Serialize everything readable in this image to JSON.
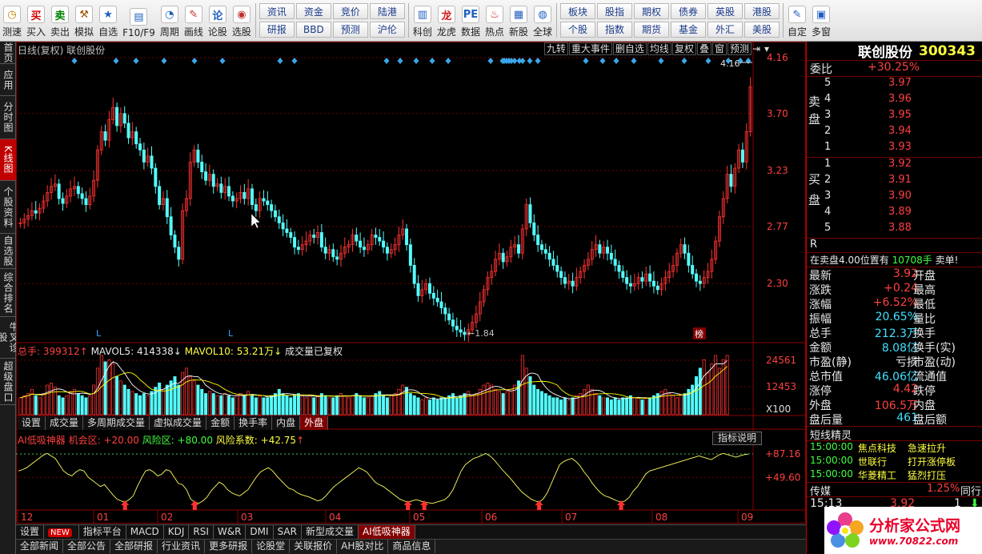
{
  "toolbar": {
    "buttons": [
      {
        "label": "测速",
        "icon": "clock-icon"
      },
      {
        "label": "买入",
        "icon": "buy-icon"
      },
      {
        "label": "卖出",
        "icon": "sell-icon"
      },
      {
        "label": "模拟",
        "icon": "hammer-icon"
      },
      {
        "label": "自选",
        "icon": "star-icon"
      },
      {
        "label": "F10/F9",
        "icon": "f10-icon"
      },
      {
        "label": "周期",
        "icon": "cycle-icon"
      },
      {
        "label": "画线",
        "icon": "pencil-icon"
      },
      {
        "label": "论股",
        "icon": "forum-icon"
      },
      {
        "label": "选股",
        "icon": "stock-pick-icon"
      }
    ],
    "grid1": [
      "资讯",
      "资金",
      "竞价",
      "陆港",
      "研报",
      "BBD",
      "预测",
      "沪伦"
    ],
    "buttons2": [
      {
        "label": "科创",
        "icon": "chart-icon"
      },
      {
        "label": "龙虎",
        "icon": "dragon-icon"
      },
      {
        "label": "数据",
        "icon": "pe-icon"
      },
      {
        "label": "热点",
        "icon": "hot-icon"
      },
      {
        "label": "新股",
        "icon": "new-stock-icon"
      },
      {
        "label": "全球",
        "icon": "globe-icon"
      }
    ],
    "grid2": [
      "板块",
      "股指",
      "期权",
      "债券",
      "英股",
      "港股",
      "个股",
      "指数",
      "期货",
      "基金",
      "外汇",
      "美股"
    ],
    "buttons3": [
      {
        "label": "自定",
        "icon": "custom-icon"
      },
      {
        "label": "多窗",
        "icon": "multi-window-icon"
      }
    ]
  },
  "lefttabs": [
    "首页",
    "应用",
    "分时图",
    "K线图",
    "个股资料",
    "自选股",
    "综合排名",
    "牛叉诊股",
    "超级盘口"
  ],
  "main": {
    "header": "日线(复权) 联创股份",
    "tools": [
      "九转",
      "重大事件",
      "删自选",
      "均线",
      "复权",
      "叠",
      "窗",
      "预测"
    ],
    "price_marker": "4.16",
    "low_marker": "1.84",
    "bang_label": "榜",
    "l_labels": [
      "L",
      "L"
    ],
    "yticks": [
      "4.16",
      "3.70",
      "3.23",
      "2.77",
      "2.30"
    ]
  },
  "volume": {
    "legend_total_label": "总手: 399312",
    "legend_mavol5": "MAVOL5: 414338",
    "legend_mavol10": "MAVOL10: 53.21万",
    "legend_note": "成交量已复权",
    "yticks": [
      "24561",
      "12453",
      "X100"
    ],
    "tabs": [
      "设置",
      "成交量",
      "多周期成交量",
      "虚拟成交量",
      "金额",
      "换手率",
      "内盘",
      "外盘"
    ]
  },
  "indicator": {
    "name": "AI低吸神器",
    "p1": "机会区: +20.00",
    "p2": "风险区: +80.00",
    "p3": "风险系数: +42.75",
    "button": "指标说明",
    "yticks": [
      "+87.16",
      "+49.60"
    ]
  },
  "xaxis": [
    "12",
    "01",
    "02",
    "03",
    "04",
    "05",
    "06",
    "07",
    "08",
    "09"
  ],
  "bottomtabs": [
    "设置",
    "NEW",
    "指标平台",
    "MACD",
    "KDJ",
    "RSI",
    "W&R",
    "DMI",
    "SAR",
    "新型成交量",
    "AI低吸神器"
  ],
  "bottomtabs2": [
    "全部新闻",
    "全部公告",
    "全部研报",
    "行业资讯",
    "更多研报",
    "论股堂",
    "关联报价",
    "AH股对比",
    "商品信息"
  ],
  "right": {
    "name": "联创股份",
    "code": "300343",
    "weibi_label": "委比",
    "weibi_value": "+30.25%",
    "sell_label": "卖盘",
    "buy_label": "买盘",
    "sells": [
      {
        "n": "5",
        "p": "3.97"
      },
      {
        "n": "4",
        "p": "3.96"
      },
      {
        "n": "3",
        "p": "3.95"
      },
      {
        "n": "2",
        "p": "3.94"
      },
      {
        "n": "1",
        "p": "3.93"
      }
    ],
    "buys": [
      {
        "n": "1",
        "p": "3.92"
      },
      {
        "n": "2",
        "p": "3.91"
      },
      {
        "n": "3",
        "p": "3.90"
      },
      {
        "n": "4",
        "p": "3.89"
      },
      {
        "n": "5",
        "p": "3.88"
      }
    ],
    "r_label": "R",
    "notice_prefix": "在卖盘4.00位置有",
    "notice_qty": "10708手",
    "notice_suffix": "卖单!",
    "stats": [
      {
        "l": "最新",
        "v": "3.92",
        "vc": "red",
        "l2": "开盘"
      },
      {
        "l": "涨跌",
        "v": "+0.24",
        "vc": "red",
        "l2": "最高"
      },
      {
        "l": "涨幅",
        "v": "+6.52%",
        "vc": "red",
        "l2": "最低"
      },
      {
        "l": "振幅",
        "v": "20.65%",
        "vc": "cyan",
        "l2": "量比"
      },
      {
        "l": "总手",
        "v": "212.3万",
        "vc": "cyan",
        "l2": "换手"
      },
      {
        "l": "金额",
        "v": "8.08亿",
        "vc": "cyan",
        "l2": "换手(实)"
      },
      {
        "l": "市盈(静)",
        "v": "亏损",
        "vc": "white",
        "l2": "市盈(动)"
      },
      {
        "l": "总市值",
        "v": "46.06亿",
        "vc": "cyan",
        "l2": "流通值"
      },
      {
        "l": "涨停",
        "v": "4.42",
        "vc": "red",
        "l2": "跌停"
      },
      {
        "l": "外盘",
        "v": "106.5万",
        "vc": "red",
        "l2": "内盘"
      },
      {
        "l": "盘后量",
        "v": "461",
        "vc": "cyan",
        "l2": "盘后额"
      }
    ],
    "elf_title": "短线精灵",
    "elf": [
      {
        "t": "15:00:00",
        "s": "焦点科技",
        "e": "急速拉升"
      },
      {
        "t": "15:00:00",
        "s": "世联行",
        "e": "打开涨停板"
      },
      {
        "t": "15:00:00",
        "s": "华菱精工",
        "e": "猛烈打压"
      }
    ],
    "sector_name": "传媒",
    "sector_pct": "1.25%",
    "sector_more": "同行",
    "tick_time": "15:13",
    "tick_price": "3.92",
    "tick_vol": "1",
    "logo_text": "分析家公式网",
    "logo_url": "www.70822.com"
  },
  "colors": {
    "up": "#ff3232",
    "down": "#54fcfc",
    "ma5": "#ffffff",
    "ma10": "#ffff00",
    "grid": "#8b0000",
    "accent": "#c00000"
  },
  "chart_data": {
    "type": "candlestick",
    "ylim": [
      1.84,
      4.16
    ],
    "closes": [
      2.8,
      2.83,
      2.86,
      2.9,
      2.88,
      2.92,
      2.98,
      3.05,
      3.1,
      3.12,
      3.0,
      2.96,
      3.02,
      3.08,
      3.1,
      3.04,
      3.0,
      2.95,
      3.02,
      3.15,
      3.4,
      3.55,
      3.48,
      3.65,
      3.75,
      3.6,
      3.7,
      3.62,
      3.5,
      3.55,
      3.45,
      3.4,
      3.3,
      3.35,
      3.25,
      3.1,
      2.95,
      3.0,
      2.85,
      2.7,
      2.6,
      2.5,
      2.9,
      3.0,
      3.3,
      3.4,
      3.3,
      3.22,
      3.15,
      3.2,
      3.1,
      3.12,
      3.05,
      3.1,
      3.02,
      2.98,
      3.0,
      3.05,
      3.0,
      3.08,
      2.95,
      2.9,
      3.0,
      2.98,
      2.95,
      2.9,
      2.85,
      2.8,
      2.75,
      2.72,
      2.68,
      2.6,
      2.58,
      2.62,
      2.65,
      2.7,
      2.68,
      2.72,
      2.6,
      2.55,
      2.58,
      2.52,
      2.5,
      2.55,
      2.6,
      2.62,
      2.7,
      2.65,
      2.6,
      2.58,
      2.62,
      2.7,
      2.68,
      2.65,
      2.6,
      2.55,
      2.58,
      2.62,
      2.7,
      2.75,
      2.62,
      2.45,
      2.3,
      2.2,
      2.25,
      2.3,
      2.22,
      2.18,
      2.15,
      2.1,
      2.05,
      2.0,
      1.95,
      1.92,
      1.9,
      1.88,
      1.92,
      1.98,
      2.05,
      2.15,
      2.25,
      2.35,
      2.4,
      2.5,
      2.55,
      2.48,
      2.52,
      2.6,
      2.62,
      2.55,
      2.75,
      2.95,
      2.8,
      2.7,
      2.62,
      2.58,
      2.55,
      2.5,
      2.45,
      2.4,
      2.35,
      2.3,
      2.32,
      2.28,
      2.35,
      2.4,
      2.45,
      2.5,
      2.58,
      2.62,
      2.55,
      2.6,
      2.55,
      2.5,
      2.45,
      2.4,
      2.35,
      2.3,
      2.28,
      2.3,
      2.35,
      2.32,
      2.38,
      2.32,
      2.28,
      2.25,
      2.3,
      2.35,
      2.4,
      2.45,
      2.55,
      2.62,
      2.55,
      2.45,
      2.38,
      2.32,
      2.3,
      2.35,
      2.4,
      2.5,
      2.65,
      2.85,
      3.0,
      3.2,
      3.1,
      3.25,
      3.4,
      3.3,
      3.55,
      3.92
    ],
    "volumes": [
      8,
      9,
      10,
      12,
      9,
      8,
      10,
      14,
      15,
      13,
      9,
      8,
      9,
      11,
      12,
      10,
      9,
      8,
      9,
      14,
      22,
      28,
      25,
      26,
      24,
      18,
      16,
      14,
      12,
      11,
      10,
      9,
      10,
      9,
      11,
      13,
      15,
      12,
      14,
      16,
      18,
      14,
      20,
      22,
      18,
      16,
      14,
      12,
      10,
      11,
      10,
      9,
      9,
      10,
      9,
      8,
      9,
      10,
      9,
      11,
      9,
      8,
      9,
      8,
      8,
      9,
      10,
      12,
      10,
      9,
      8,
      9,
      10,
      9,
      8,
      9,
      8,
      9,
      10,
      9,
      8,
      8,
      9,
      10,
      9,
      8,
      9,
      10,
      9,
      8,
      8,
      9,
      10,
      11,
      9,
      8,
      9,
      10,
      12,
      14,
      13,
      10,
      9,
      8,
      7,
      8,
      7,
      8,
      7,
      8,
      8,
      9,
      10,
      8,
      9,
      10,
      11,
      9,
      10,
      12,
      14,
      15,
      14,
      12,
      11,
      10,
      11,
      12,
      14,
      16,
      28,
      22,
      18,
      14,
      12,
      11,
      10,
      9,
      8,
      8,
      7,
      8,
      7,
      8,
      9,
      10,
      12,
      14,
      12,
      10,
      9,
      8,
      8,
      7,
      8,
      7,
      8,
      8,
      9,
      8,
      8,
      7,
      8,
      8,
      9,
      10,
      11,
      12,
      10,
      9,
      8,
      9,
      10,
      12,
      14,
      18,
      22,
      26,
      20,
      24,
      28,
      22,
      26,
      28
    ],
    "indicator": [
      60,
      62,
      65,
      70,
      75,
      80,
      85,
      88,
      84,
      80,
      70,
      60,
      55,
      52,
      58,
      62,
      60,
      50,
      45,
      40,
      35,
      38,
      30,
      22,
      15,
      12,
      10,
      14,
      20,
      35,
      48,
      60,
      62,
      58,
      52,
      55,
      62,
      60,
      50,
      40,
      38,
      30,
      15,
      10,
      8,
      12,
      18,
      28,
      35,
      42,
      38,
      30,
      25,
      22,
      20,
      25,
      30,
      40,
      50,
      58,
      62,
      65,
      60,
      52,
      45,
      38,
      32,
      30,
      25,
      22,
      20,
      18,
      15,
      12,
      14,
      20,
      28,
      35,
      40,
      45,
      50,
      55,
      60,
      65,
      62,
      58,
      50,
      42,
      38,
      35,
      30,
      25,
      20,
      15,
      12,
      10,
      12,
      14,
      12,
      10,
      9,
      8,
      10,
      12,
      14,
      20,
      30,
      45,
      60,
      70,
      75,
      80,
      82,
      85,
      88,
      84,
      78,
      70,
      62,
      55,
      48,
      40,
      32,
      25,
      20,
      15,
      12,
      10,
      15,
      25,
      40,
      55,
      70,
      75,
      78,
      80,
      75,
      68,
      58,
      50,
      40,
      32,
      25,
      20,
      18,
      15,
      12,
      10,
      12,
      18,
      28,
      35,
      45,
      55,
      60,
      62,
      64,
      66,
      68,
      70,
      72,
      74,
      76,
      78,
      80,
      82,
      84,
      82,
      80,
      78,
      82,
      86,
      88,
      86,
      84,
      82,
      84,
      86,
      87
    ]
  }
}
